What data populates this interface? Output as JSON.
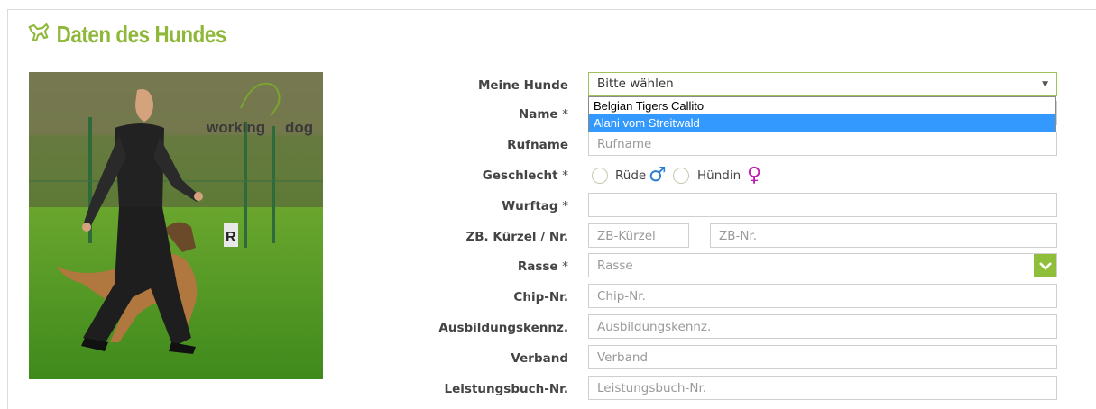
{
  "section": {
    "title": "Daten des Hundes"
  },
  "photo": {
    "logo_text_1": "working",
    "logo_text_2": "dog",
    "sign_letter": "R"
  },
  "form": {
    "meine_hunde": {
      "label": "Meine Hunde",
      "value": "Bitte wählen",
      "options": [
        "Belgian Tigers Callito",
        "Alani vom Streitwald"
      ],
      "highlighted": "Alani vom Streitwald"
    },
    "name": {
      "label": "Name",
      "required": "*"
    },
    "rufname": {
      "label": "Rufname",
      "placeholder": "Rufname"
    },
    "geschlecht": {
      "label": "Geschlecht",
      "required": "*",
      "options": [
        {
          "label": "Rüde",
          "symbol": "♂",
          "color": "#2a7bd4"
        },
        {
          "label": "Hündin",
          "symbol": "♀",
          "color": "#c21fb0"
        }
      ]
    },
    "wurftag": {
      "label": "Wurftag",
      "required": "*"
    },
    "zb": {
      "label": "ZB. Kürzel / Nr.",
      "placeholder_kuerzel": "ZB-Kürzel",
      "placeholder_nr": "ZB-Nr."
    },
    "rasse": {
      "label": "Rasse",
      "required": "*",
      "placeholder": "Rasse"
    },
    "chip": {
      "label": "Chip-Nr.",
      "placeholder": "Chip-Nr."
    },
    "ausbildung": {
      "label": "Ausbildungskennz.",
      "placeholder": "Ausbildungskennz."
    },
    "verband": {
      "label": "Verband",
      "placeholder": "Verband"
    },
    "leistungsbuch": {
      "label": "Leistungsbuch-Nr.",
      "placeholder": "Leistungsbuch-Nr."
    }
  },
  "colors": {
    "accent": "#8fb83a",
    "dropdown_highlight": "#3399ff"
  }
}
